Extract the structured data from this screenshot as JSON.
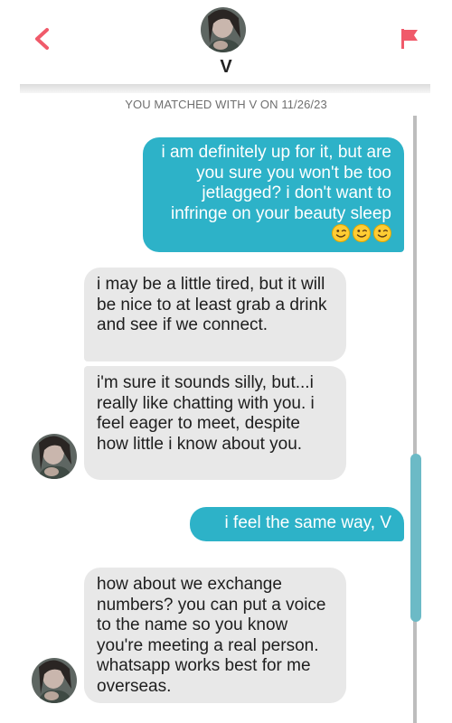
{
  "header": {
    "name": "V",
    "back_icon": "chevron-left-icon",
    "flag_icon": "flag-icon",
    "accent_color": "#f05a6a"
  },
  "match_note": "YOU MATCHED WITH V ON 11/26/23",
  "messages": [
    {
      "direction": "outgoing",
      "text": "i am definitely up for it, but are you sure you won't be too jetlagged? i don't want to infringe on your beauty sleep",
      "emoji": "😉😉😉"
    },
    {
      "direction": "incoming",
      "text": "i may be a little tired, but it will be nice to at least grab a drink and see if we connect."
    },
    {
      "direction": "incoming",
      "text": "i'm sure it sounds silly, but...i really like chatting with you. i feel eager to meet, despite how little i know about you."
    },
    {
      "direction": "outgoing",
      "text": "i feel the same way, V"
    },
    {
      "direction": "incoming",
      "text": "how about we exchange numbers? you can put a voice to the name so you know you're meeting a real person. whatsapp works best for me overseas."
    }
  ],
  "colors": {
    "outgoing_bubble": "#2db2c8",
    "incoming_bubble": "#e8e8e8",
    "scroll_thumb": "#6cbac6"
  }
}
